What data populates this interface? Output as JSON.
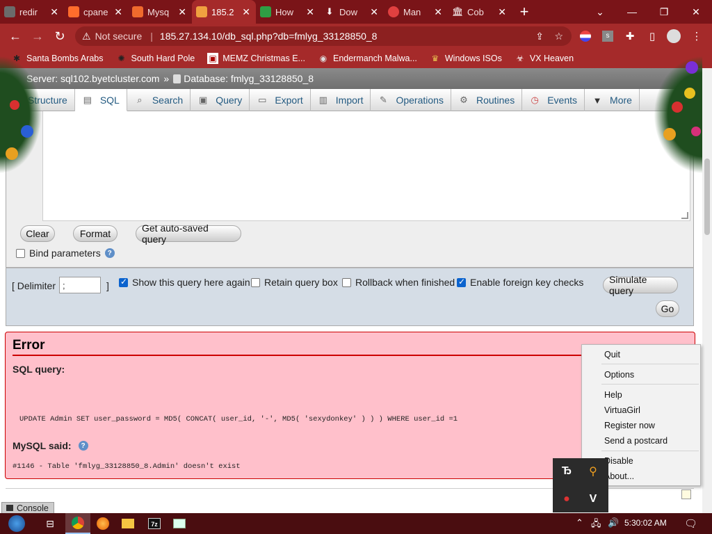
{
  "browser": {
    "tabs": [
      {
        "label": "redir",
        "color": "#6b6b6b"
      },
      {
        "label": "cpane",
        "color": "#ff6c2c"
      },
      {
        "label": "Mysq",
        "color": "#f06a2d"
      },
      {
        "label": "185.2",
        "color": "#f0a040",
        "active": true
      },
      {
        "label": "How",
        "color": "#2f9e44"
      },
      {
        "label": "Dow",
        "color": "#e6e6e6"
      },
      {
        "label": "Man",
        "color": "#e04040"
      },
      {
        "label": "Cob",
        "color": "#cccccc"
      }
    ],
    "new_tab": "+",
    "address": {
      "security": "Not secure",
      "url": "185.27.134.10/db_sql.php?db=fmlyg_33128850_8"
    },
    "bookmarks": [
      {
        "label": "Santa Bombs Arabs"
      },
      {
        "label": "South Hard Pole"
      },
      {
        "label": "MEMZ Christmas E..."
      },
      {
        "label": "Endermanch Malwa..."
      },
      {
        "label": "Windows ISOs"
      },
      {
        "label": "VX Heaven"
      }
    ]
  },
  "pma": {
    "breadcrumb": {
      "server": "Server: sql102.byetcluster.com",
      "sep": "»",
      "database": "Database: fmlyg_33128850_8"
    },
    "tabs": [
      {
        "label": "Structure",
        "icon": "▦"
      },
      {
        "label": "SQL",
        "icon": "▤",
        "active": true
      },
      {
        "label": "Search",
        "icon": "🔍"
      },
      {
        "label": "Query",
        "icon": "▣"
      },
      {
        "label": "Export",
        "icon": "▭"
      },
      {
        "label": "Import",
        "icon": "▥"
      },
      {
        "label": "Operations",
        "icon": "🔧"
      },
      {
        "label": "Routines",
        "icon": "⚙"
      },
      {
        "label": "Events",
        "icon": "◷"
      },
      {
        "label": "More",
        "icon": "▼"
      }
    ],
    "buttons": {
      "clear": "Clear",
      "format": "Format",
      "autosaved": "Get auto-saved query",
      "simulate": "Simulate query",
      "go": "Go"
    },
    "bind_params": "Bind parameters",
    "delimiter": {
      "label": "[ Delimiter",
      "value": ";",
      "close": "]"
    },
    "options": [
      {
        "label": "Show this query here again",
        "checked": true
      },
      {
        "label": "Retain query box",
        "checked": false
      },
      {
        "label": "Rollback when finished",
        "checked": false
      },
      {
        "label": "Enable foreign key checks",
        "checked": true
      }
    ],
    "error": {
      "title": "Error",
      "sql_query_label": "SQL query:",
      "query": "UPDATE Admin SET user_password = MD5( CONCAT( user_id, '-', MD5( 'sexydonkey' ) ) ) WHERE user_id =1",
      "mysql_said": "MySQL said:",
      "message": "#1146 - Table 'fmlyg_33128850_8.Admin' doesn't exist"
    },
    "console": "Console"
  },
  "context_menu": {
    "items": [
      "Quit",
      "Options",
      "Help",
      "VirtuaGirl",
      "Register now",
      "Send a postcard",
      "Disable",
      "About..."
    ]
  },
  "taskbar": {
    "clock": "5:30:02 AM"
  }
}
